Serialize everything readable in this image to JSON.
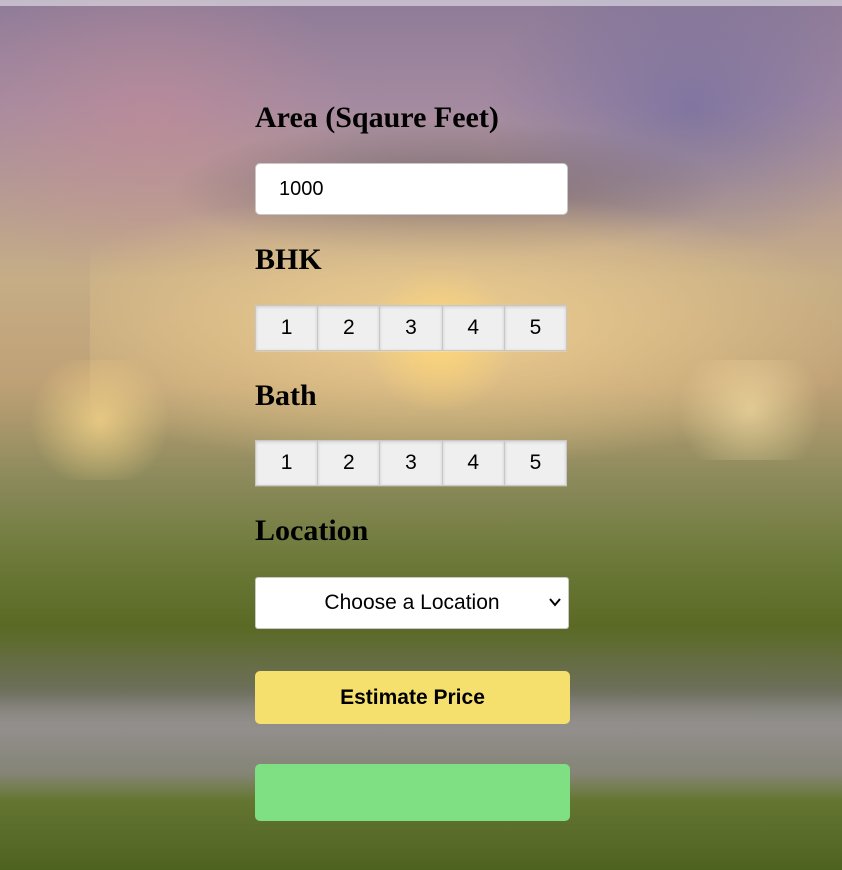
{
  "form": {
    "area": {
      "label": "Area (Sqaure Feet)",
      "value": "1000"
    },
    "bhk": {
      "label": "BHK",
      "options": [
        "1",
        "2",
        "3",
        "4",
        "5"
      ]
    },
    "bath": {
      "label": "Bath",
      "options": [
        "1",
        "2",
        "3",
        "4",
        "5"
      ]
    },
    "location": {
      "label": "Location",
      "selected": "Choose a Location"
    },
    "estimate_button": "Estimate Price",
    "result": ""
  },
  "colors": {
    "estimate_button": "#f5e06d",
    "result_box": "#7fe083"
  }
}
